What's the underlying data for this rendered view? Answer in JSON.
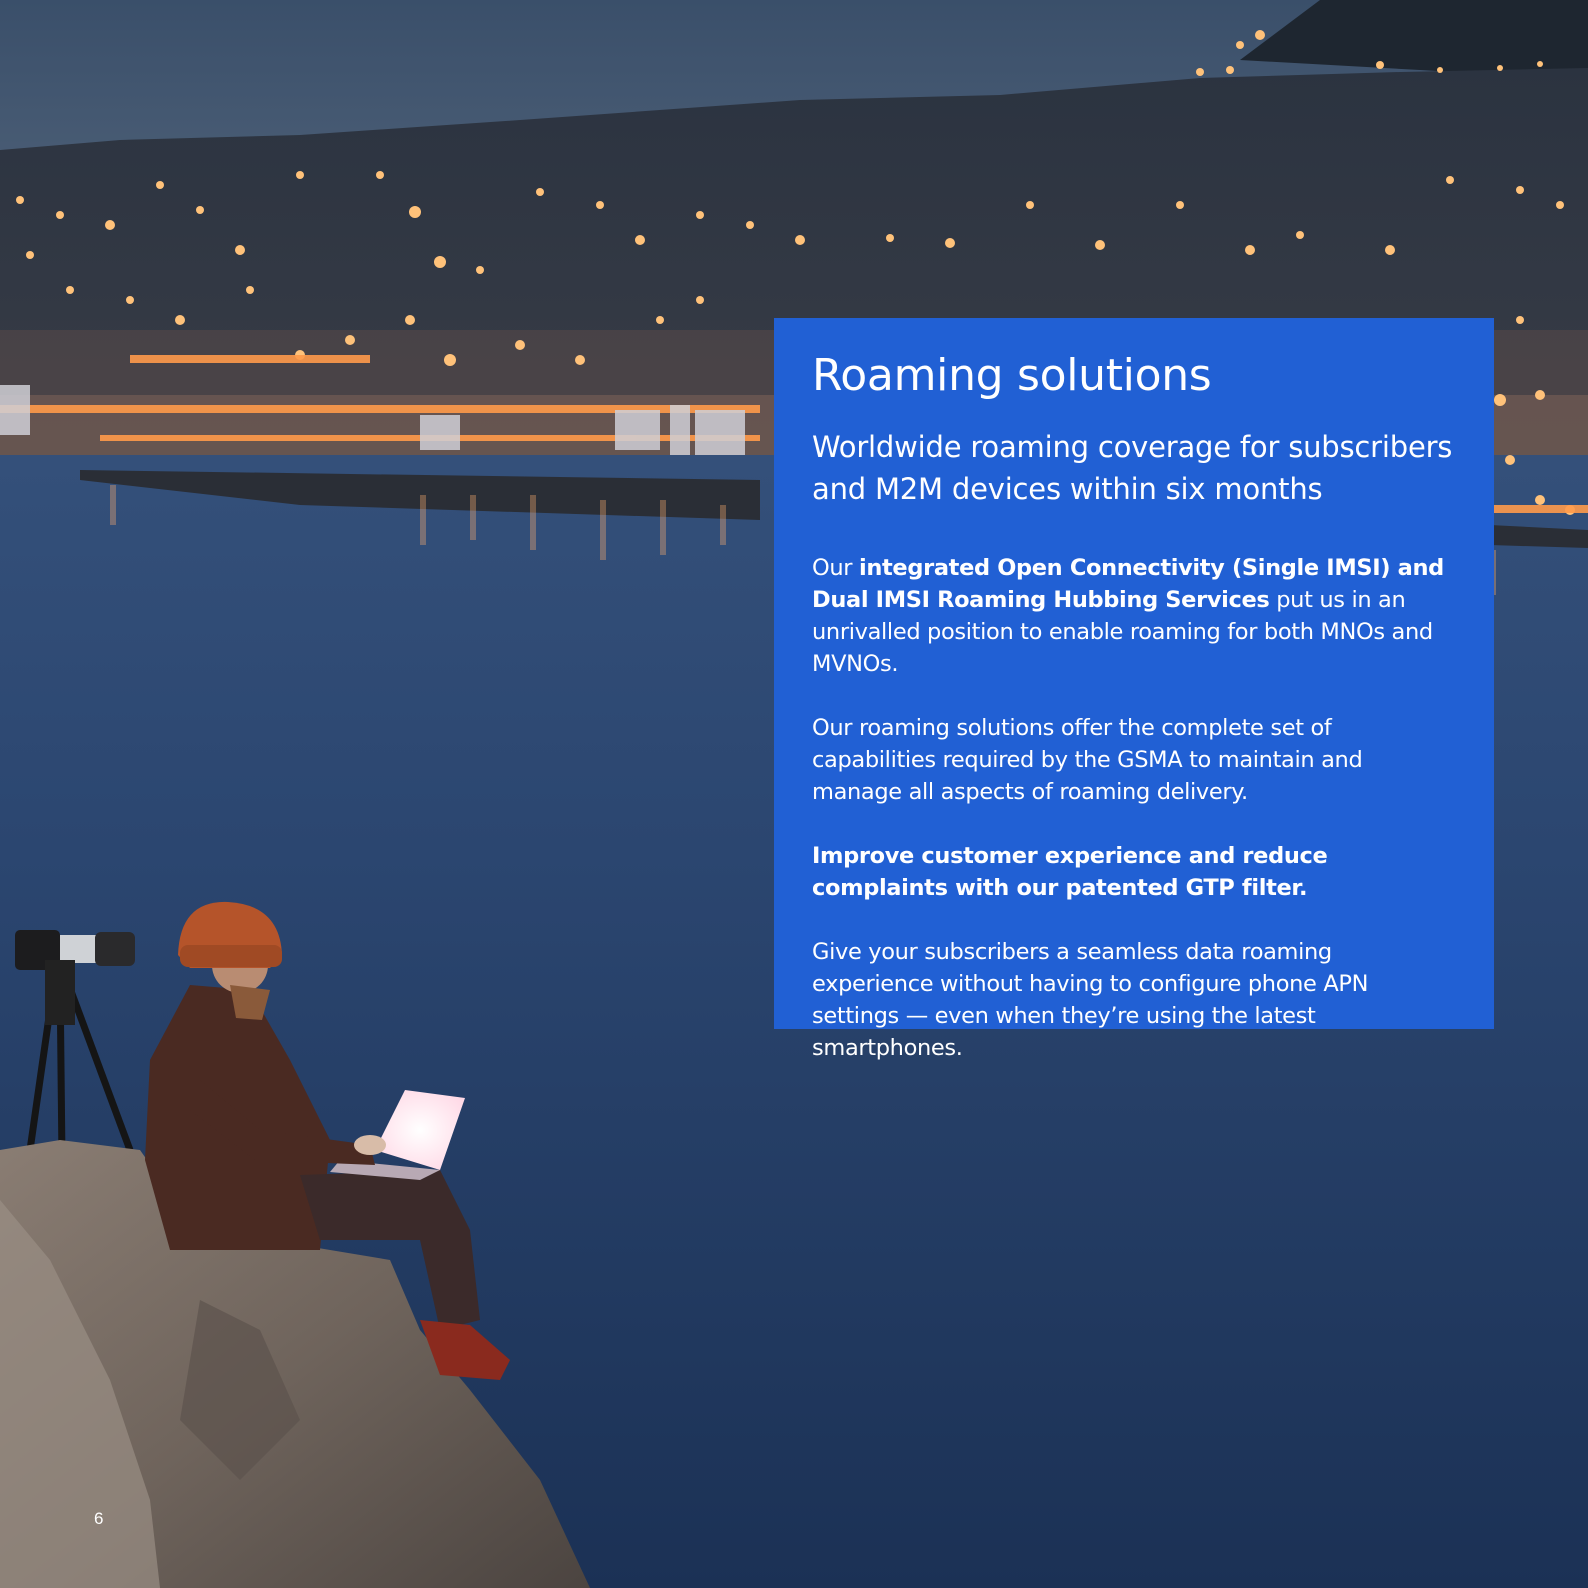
{
  "panel": {
    "title": "Roaming solutions",
    "subtitle": "Worldwide roaming coverage for subscribers and M2M devices within six months",
    "p1": {
      "pre": "Our ",
      "bold": "integrated Open Connectivity (Single IMSI) and Dual IMSI Roaming Hubbing Services",
      "post": " put us in an unrivalled position to enable roaming for both MNOs and MVNOs."
    },
    "p2": "Our roaming solutions offer the complete set of capabilities required by the GSMA to maintain and manage all aspects of roaming delivery.",
    "p3": "Improve customer experience and reduce complaints with our patented GTP filter.",
    "p4": "Give your subscribers a seamless data roaming experience without having to configure phone APN settings — even when they’re using the latest smartphones."
  },
  "page_number": "6",
  "colors": {
    "panel_background": "#2160d4",
    "text": "#ffffff"
  }
}
